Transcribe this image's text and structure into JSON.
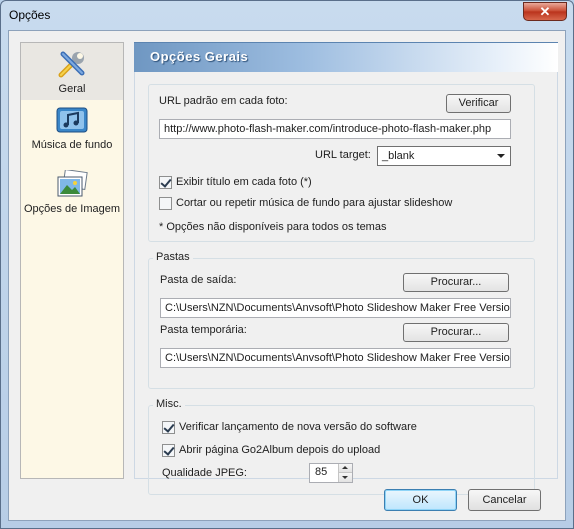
{
  "window": {
    "title": "Opções",
    "close_symbol": "✕"
  },
  "nav": {
    "items": [
      {
        "label": "Geral",
        "icon": "tools-icon",
        "selected": true
      },
      {
        "label": "Música de fundo",
        "icon": "music-icon",
        "selected": false
      },
      {
        "label": "Opções de Imagem",
        "icon": "image-icon",
        "selected": false
      }
    ]
  },
  "header": {
    "title": "Opções Gerais"
  },
  "general": {
    "url_label": "URL padrão em cada foto:",
    "verify_button": "Verificar",
    "url_value": "http://www.photo-flash-maker.com/introduce-photo-flash-maker.php",
    "url_target_label": "URL target:",
    "url_target_value": "_blank",
    "show_title_label": "Exibir título em cada foto (*)",
    "show_title_checked": true,
    "cut_music_label": "Cortar ou repetir música de fundo para ajustar slideshow",
    "cut_music_checked": false,
    "note": "* Opções não disponíveis para todos os temas"
  },
  "folders": {
    "legend": "Pastas",
    "output_label": "Pasta de saída:",
    "output_browse": "Procurar...",
    "output_value": "C:\\Users\\NZN\\Documents\\Anvsoft\\Photo Slideshow Maker Free Version",
    "temp_label": "Pasta temporária:",
    "temp_browse": "Procurar...",
    "temp_value": "C:\\Users\\NZN\\Documents\\Anvsoft\\Photo Slideshow Maker Free Version"
  },
  "misc": {
    "legend": "Misc.",
    "check_update_label": "Verificar lançamento de nova versão do software",
    "check_update_checked": true,
    "open_page_label": "Abrir página Go2Album depois do upload",
    "open_page_checked": true,
    "jpeg_label": "Qualidade JPEG:",
    "jpeg_value": "85"
  },
  "footer": {
    "ok": "OK",
    "cancel": "Cancelar"
  },
  "colors": {
    "header_start": "#6f97c2",
    "nav_bg": "#fdf8e6",
    "ok_border": "#3c7fb1"
  }
}
